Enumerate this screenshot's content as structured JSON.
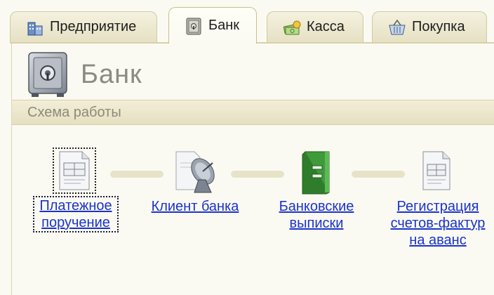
{
  "tabs": [
    {
      "label": "Предприятие",
      "icon": "enterprise-icon",
      "active": false
    },
    {
      "label": "Банк",
      "icon": "bank-icon",
      "active": true
    },
    {
      "label": "Касса",
      "icon": "cash-icon",
      "active": false
    },
    {
      "label": "Покупка",
      "icon": "basket-icon",
      "active": false
    }
  ],
  "page": {
    "title": "Банк",
    "icon": "safe-icon"
  },
  "section": {
    "title": "Схема работы"
  },
  "scheme": {
    "nodes": [
      {
        "label_line1": "Платежное",
        "label_line2": "поручение",
        "label_line3": "",
        "icon": "payment-order-document-icon",
        "focused": true
      },
      {
        "label_line1": "Клиент банка",
        "label_line2": "",
        "label_line3": "",
        "icon": "satellite-dish-icon",
        "focused": false
      },
      {
        "label_line1": "Банковские",
        "label_line2": "выписки",
        "label_line3": "",
        "icon": "green-binder-icon",
        "focused": false
      },
      {
        "label_line1": "Регистрация",
        "label_line2": "счетов-фактур",
        "label_line3": "на аванс",
        "icon": "invoice-document-icon",
        "focused": false
      }
    ]
  },
  "colors": {
    "link": "#1a33cc",
    "background": "#fbfaf2",
    "section_bar": "#e9e4c6",
    "connector": "#e7e3c9"
  }
}
